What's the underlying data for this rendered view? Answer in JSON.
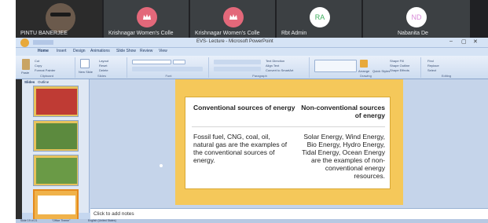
{
  "participants": [
    {
      "name": "PINTU BANERJEE",
      "type": "video"
    },
    {
      "name": "Krishnagar Women's Colle",
      "type": "avatar",
      "initials": "",
      "color": "#e3687a"
    },
    {
      "name": "Krishnagar Women's Colle",
      "type": "avatar",
      "initials": "",
      "color": "#e3687a"
    },
    {
      "name": "Rbt Admin",
      "type": "avatar",
      "initials": "RA",
      "color": "#ffffff",
      "text_color": "#3fae5d"
    },
    {
      "name": "Nabanita De",
      "type": "avatar",
      "initials": "ND",
      "color": "#ffffff",
      "text_color": "#d98ad8"
    }
  ],
  "window": {
    "title": "EVS- Lecture - Microsoft PowerPoint",
    "controls": [
      "–",
      "▢",
      "✕"
    ]
  },
  "ribbon": {
    "tabs": [
      "Home",
      "Insert",
      "Design",
      "Animations",
      "Slide Show",
      "Review",
      "View"
    ],
    "groups": [
      "Clipboard",
      "Slides",
      "Font",
      "Paragraph",
      "Drawing",
      "Editing"
    ],
    "buttons": {
      "paste": "Paste",
      "cut": "Cut",
      "copy": "Copy",
      "format_painter": "Format Painter",
      "new_slide": "New Slide",
      "layout": "Layout",
      "reset": "Reset",
      "delete": "Delete",
      "text_direction": "Text Direction",
      "align_text": "Align Text",
      "convert_smartart": "Convert to SmartArt",
      "arrange": "Arrange",
      "quick_styles": "Quick Styles",
      "shape_fill": "Shape Fill",
      "shape_outline": "Shape Outline",
      "shape_effects": "Shape Effects",
      "find": "Find",
      "replace": "Replace",
      "select": "Select"
    }
  },
  "pane_tabs": [
    "Slides",
    "Outline"
  ],
  "slide": {
    "left_heading": "Conventional sources of energy",
    "right_heading": "Non-conventional sources of energy",
    "left_body": "Fossil fuel, CNG, coal, oil, natural gas are the examples of the conventional sources of energy.",
    "right_body": "Solar Energy, Wind Energy, Bio Energy, Hydro Energy, Tidal Energy, Ocean Energy are the examples of non-conventional energy resources."
  },
  "thumbnails": [
    {
      "number": "",
      "color": "#f0b24a"
    },
    {
      "number": "",
      "color": "#f0b24a"
    },
    {
      "number": "",
      "color": "#f0b24a"
    },
    {
      "number": "",
      "color": "#f0b24a"
    }
  ],
  "notes_placeholder": "Click to add notes",
  "status": {
    "slide_info": "Slide 19 of 21",
    "theme": "\"Office Theme\"",
    "language": "English (United States)"
  },
  "colors": {
    "slide_background": "#f5c85a",
    "ribbon": "#dce6f4",
    "accent": "#e3687a"
  }
}
